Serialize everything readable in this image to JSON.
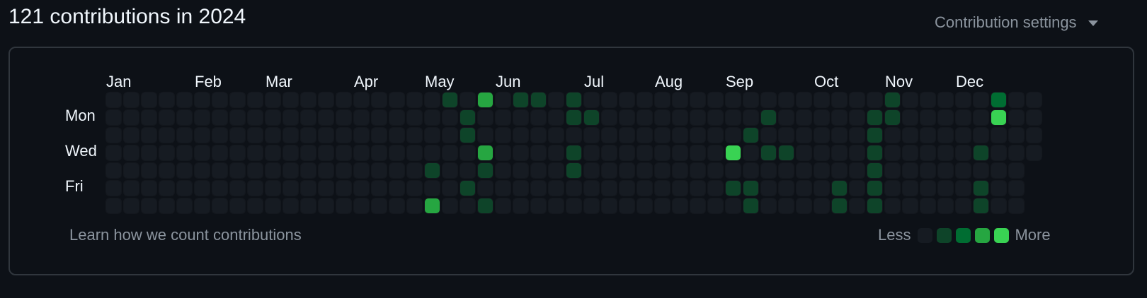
{
  "header": {
    "title": "121 contributions in 2024",
    "settings_label": "Contribution settings",
    "settings_icon": "caret-down-icon"
  },
  "months": [
    {
      "label": "Jan",
      "week": 0
    },
    {
      "label": "Feb",
      "week": 5
    },
    {
      "label": "Mar",
      "week": 9
    },
    {
      "label": "Apr",
      "week": 14
    },
    {
      "label": "May",
      "week": 18
    },
    {
      "label": "Jun",
      "week": 22
    },
    {
      "label": "Jul",
      "week": 27
    },
    {
      "label": "Aug",
      "week": 31
    },
    {
      "label": "Sep",
      "week": 35
    },
    {
      "label": "Oct",
      "week": 40
    },
    {
      "label": "Nov",
      "week": 44
    },
    {
      "label": "Dec",
      "week": 48
    }
  ],
  "day_labels": {
    "mon": "Mon",
    "wed": "Wed",
    "fri": "Fri"
  },
  "calendar": {
    "weeks": 53,
    "first_week_start_row": 1,
    "last_week_end_row": 3,
    "active_cells": [
      [
        19,
        0,
        1
      ],
      [
        18,
        4,
        1
      ],
      [
        18,
        6,
        3
      ],
      [
        20,
        1,
        1
      ],
      [
        20,
        2,
        1
      ],
      [
        20,
        5,
        1
      ],
      [
        21,
        0,
        3
      ],
      [
        21,
        3,
        3
      ],
      [
        21,
        4,
        1
      ],
      [
        21,
        6,
        1
      ],
      [
        23,
        0,
        1
      ],
      [
        24,
        0,
        1
      ],
      [
        26,
        0,
        1
      ],
      [
        26,
        1,
        1
      ],
      [
        26,
        3,
        1
      ],
      [
        26,
        4,
        1
      ],
      [
        27,
        1,
        1
      ],
      [
        35,
        3,
        4
      ],
      [
        35,
        5,
        1
      ],
      [
        36,
        2,
        1
      ],
      [
        36,
        5,
        1
      ],
      [
        36,
        6,
        1
      ],
      [
        37,
        1,
        1
      ],
      [
        37,
        3,
        1
      ],
      [
        38,
        3,
        1
      ],
      [
        41,
        5,
        1
      ],
      [
        41,
        6,
        1
      ],
      [
        43,
        1,
        1
      ],
      [
        43,
        2,
        1
      ],
      [
        43,
        3,
        1
      ],
      [
        43,
        4,
        1
      ],
      [
        43,
        5,
        1
      ],
      [
        43,
        6,
        1
      ],
      [
        44,
        0,
        1
      ],
      [
        44,
        1,
        1
      ],
      [
        49,
        3,
        1
      ],
      [
        49,
        5,
        1
      ],
      [
        49,
        6,
        1
      ],
      [
        50,
        0,
        2
      ],
      [
        50,
        1,
        5
      ]
    ]
  },
  "colors": {
    "level0": "#161b22",
    "level1": "#0e4429",
    "level2": "#006d32",
    "level3": "#26a641",
    "level4": "#39d353",
    "cell_empty": "#161b22",
    "bright": "#39d353"
  },
  "footer": {
    "learn_link": "Learn how we count contributions",
    "legend_less": "Less",
    "legend_more": "More"
  }
}
